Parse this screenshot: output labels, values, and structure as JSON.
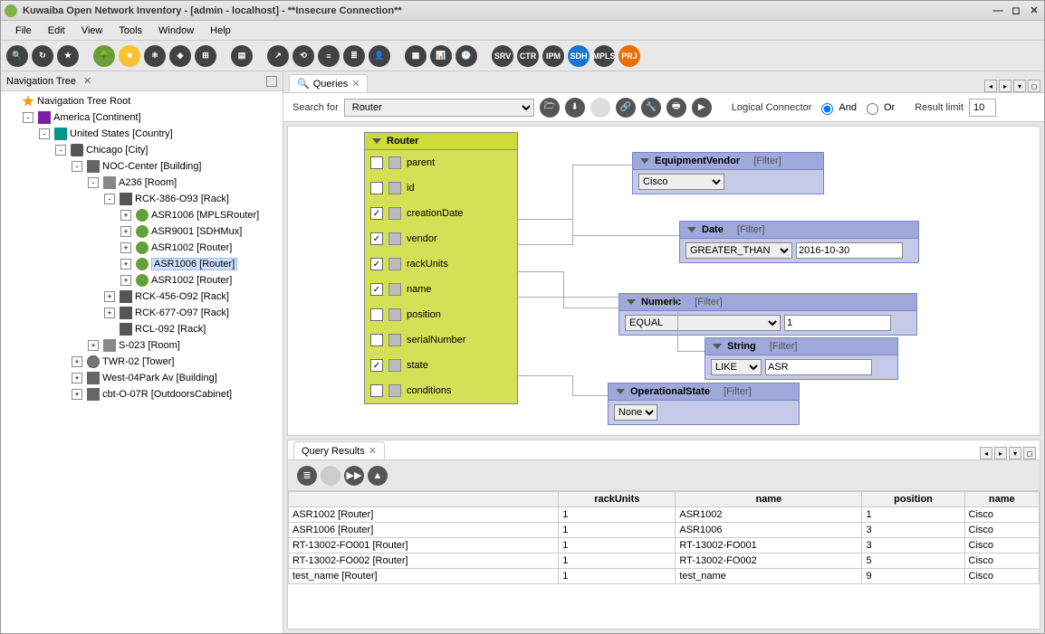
{
  "window": {
    "title": "Kuwaiba Open Network Inventory - [admin - localhost] - **Insecure Connection**"
  },
  "menu": [
    "File",
    "Edit",
    "View",
    "Tools",
    "Window",
    "Help"
  ],
  "toolbar_icons": [
    {
      "name": "search-icon",
      "cls": "dk",
      "txt": "🔍"
    },
    {
      "name": "refresh-icon",
      "cls": "dk",
      "txt": "↻"
    },
    {
      "name": "star-icon",
      "cls": "dk",
      "txt": "★"
    },
    {
      "name": "sep"
    },
    {
      "name": "tree-icon",
      "cls": "grn",
      "txt": "🌳"
    },
    {
      "name": "fav-icon",
      "cls": "ylw",
      "txt": "★"
    },
    {
      "name": "graph-icon",
      "cls": "dk",
      "txt": "⚛"
    },
    {
      "name": "nav-icon",
      "cls": "dk",
      "txt": "◈"
    },
    {
      "name": "grid-icon",
      "cls": "dk",
      "txt": "⊞"
    },
    {
      "name": "sep"
    },
    {
      "name": "rack-icon",
      "cls": "dk",
      "txt": "▤"
    },
    {
      "name": "sep"
    },
    {
      "name": "export-icon",
      "cls": "dk",
      "txt": "↗"
    },
    {
      "name": "sync-icon",
      "cls": "dk",
      "txt": "⟲"
    },
    {
      "name": "list-icon",
      "cls": "dk",
      "txt": "≡"
    },
    {
      "name": "doc-icon",
      "cls": "dk",
      "txt": "≣"
    },
    {
      "name": "user-icon",
      "cls": "dk",
      "txt": "👤"
    },
    {
      "name": "sep"
    },
    {
      "name": "task-icon",
      "cls": "dk",
      "txt": "▦"
    },
    {
      "name": "chart-icon",
      "cls": "dk",
      "txt": "📊"
    },
    {
      "name": "clock-icon",
      "cls": "dk",
      "txt": "🕐"
    },
    {
      "name": "sep"
    },
    {
      "name": "srv-icon",
      "cls": "dk",
      "txt": "SRV"
    },
    {
      "name": "ctr-icon",
      "cls": "dk",
      "txt": "CTR"
    },
    {
      "name": "ipm-icon",
      "cls": "dk",
      "txt": "IPM"
    },
    {
      "name": "sdh-icon",
      "cls": "blue",
      "txt": "SDH"
    },
    {
      "name": "mpls-icon",
      "cls": "dk",
      "txt": "MPLS"
    },
    {
      "name": "prj-icon",
      "cls": "orn",
      "txt": "PRJ"
    }
  ],
  "nav_panel_title": "Navigation Tree",
  "tree": [
    {
      "indent": 0,
      "toggle": "",
      "icon": "ic-star",
      "label": "Navigation Tree Root"
    },
    {
      "indent": 1,
      "toggle": "-",
      "icon": "ic-cont",
      "label": "America [Continent]"
    },
    {
      "indent": 2,
      "toggle": "-",
      "icon": "ic-ctry",
      "label": "United States [Country]"
    },
    {
      "indent": 3,
      "toggle": "-",
      "icon": "ic-city",
      "label": "Chicago [City]"
    },
    {
      "indent": 4,
      "toggle": "-",
      "icon": "ic-bldg",
      "label": "NOC-Center [Building]"
    },
    {
      "indent": 5,
      "toggle": "-",
      "icon": "ic-room",
      "label": "A236 [Room]"
    },
    {
      "indent": 6,
      "toggle": "-",
      "icon": "ic-rack",
      "label": "RCK-386-O93 [Rack]"
    },
    {
      "indent": 7,
      "toggle": "+",
      "icon": "ic-dev",
      "label": "ASR1006 [MPLSRouter]"
    },
    {
      "indent": 7,
      "toggle": "+",
      "icon": "ic-dev",
      "label": "ASR9001 [SDHMux]"
    },
    {
      "indent": 7,
      "toggle": "+",
      "icon": "ic-dev",
      "label": "ASR1002 [Router]"
    },
    {
      "indent": 7,
      "toggle": "+",
      "icon": "ic-dev",
      "label": "ASR1006 [Router]",
      "selected": true
    },
    {
      "indent": 7,
      "toggle": "+",
      "icon": "ic-dev",
      "label": "ASR1002 [Router]"
    },
    {
      "indent": 6,
      "toggle": "+",
      "icon": "ic-rack",
      "label": "RCK-456-O92 [Rack]"
    },
    {
      "indent": 6,
      "toggle": "+",
      "icon": "ic-rack",
      "label": "RCK-677-O97 [Rack]"
    },
    {
      "indent": 6,
      "toggle": "",
      "icon": "ic-rack",
      "label": "RCL-092 [Rack]"
    },
    {
      "indent": 5,
      "toggle": "+",
      "icon": "ic-room",
      "label": "S-023 [Room]"
    },
    {
      "indent": 4,
      "toggle": "+",
      "icon": "ic-tower",
      "label": "TWR-02 [Tower]"
    },
    {
      "indent": 4,
      "toggle": "+",
      "icon": "ic-bldg",
      "label": "West-04Park Av [Building]"
    },
    {
      "indent": 4,
      "toggle": "+",
      "icon": "ic-bldg",
      "label": "cbt-O-07R [OutdoorsCabinet]"
    }
  ],
  "queries_tab": "Queries",
  "search_label": "Search for",
  "search_value": "Router",
  "query_connector_label": "Logical Connector",
  "and_label": "And",
  "or_label": "Or",
  "result_limit_label": "Result limit",
  "result_limit_value": "10",
  "router_node": {
    "title": "Router",
    "attrs": [
      {
        "name": "parent",
        "checked": false
      },
      {
        "name": "id",
        "checked": false
      },
      {
        "name": "creationDate",
        "checked": true
      },
      {
        "name": "vendor",
        "checked": true
      },
      {
        "name": "rackUnits",
        "checked": true
      },
      {
        "name": "name",
        "checked": true
      },
      {
        "name": "position",
        "checked": false
      },
      {
        "name": "serialNumber",
        "checked": false
      },
      {
        "name": "state",
        "checked": true
      },
      {
        "name": "conditions",
        "checked": false
      }
    ]
  },
  "filters": {
    "vendor": {
      "title": "EquipmentVendor",
      "tag": "[Filter]",
      "value": "Cisco"
    },
    "date": {
      "title": "Date",
      "tag": "[Filter]",
      "op": "GREATER_THAN",
      "value": "2016-10-30"
    },
    "numeric": {
      "title": "Numeric",
      "tag": "[Filter]",
      "op": "EQUAL",
      "value": "1"
    },
    "string": {
      "title": "String",
      "tag": "[Filter]",
      "op": "LIKE",
      "value": "ASR"
    },
    "opstate": {
      "title": "OperationalState",
      "tag": "[Filter]",
      "value": "None"
    }
  },
  "results_tab": "Query Results",
  "results": {
    "columns": [
      "",
      "rackUnits",
      "name",
      "position",
      "name"
    ],
    "rows": [
      [
        "ASR1002 [Router]",
        "1",
        "ASR1002",
        "1",
        "Cisco"
      ],
      [
        "ASR1006 [Router]",
        "1",
        "ASR1006",
        "3",
        "Cisco"
      ],
      [
        "RT-13002-FO001 [Router]",
        "1",
        "RT-13002-FO001",
        "3",
        "Cisco"
      ],
      [
        "RT-13002-FO002 [Router]",
        "1",
        "RT-13002-FO002",
        "5",
        "Cisco"
      ],
      [
        "test_name [Router]",
        "1",
        "test_name",
        "9",
        "Cisco"
      ]
    ]
  }
}
